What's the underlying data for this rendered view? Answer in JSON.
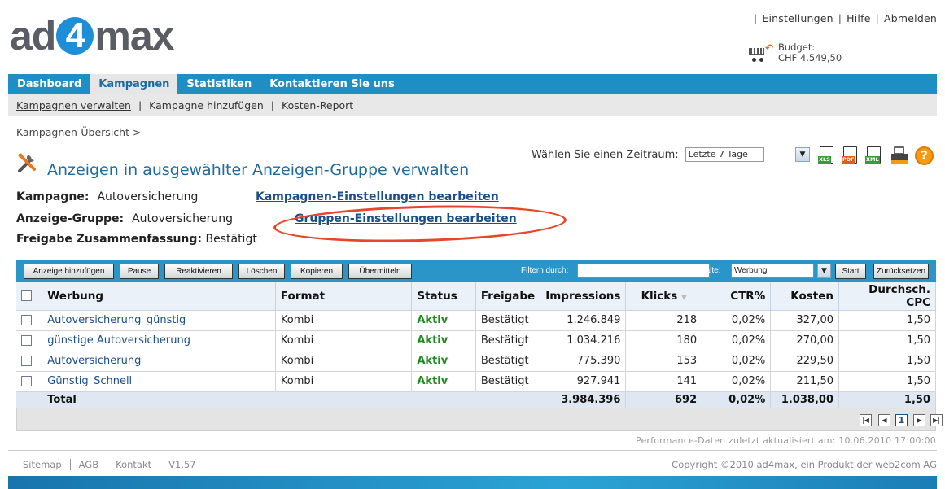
{
  "top_links": [
    "Einstellungen",
    "Hilfe",
    "Abmelden"
  ],
  "logo": {
    "pre": "ad",
    "mid": "4",
    "post": "max"
  },
  "budget": {
    "label": "Budget:",
    "value": "CHF 4.549,50"
  },
  "main_nav": [
    {
      "label": "Dashboard",
      "active": false
    },
    {
      "label": "Kampagnen",
      "active": true
    },
    {
      "label": "Statistiken",
      "active": false
    },
    {
      "label": "Kontaktieren Sie uns",
      "active": false
    }
  ],
  "sub_nav": [
    "Kampagnen verwalten",
    "Kampagne hinzufügen",
    "Kosten-Report"
  ],
  "breadcrumb": "Kampagnen-Übersicht >",
  "page_title": "Anzeigen in ausgewählter Anzeigen-Gruppe verwalten",
  "period": {
    "label": "Wählen Sie einen Zeitraum:",
    "selected": "Letzte 7 Tage"
  },
  "export_icons": [
    "XLS",
    "PDF",
    "XML"
  ],
  "info": {
    "kampagne_label": "Kampagne:",
    "kampagne_value": "Autoversicherung",
    "kampagne_link": "Kampagnen-Einstellungen bearbeiten",
    "gruppe_label": "Anzeige-Gruppe:",
    "gruppe_value": "Autoversicherung",
    "gruppe_link": "Gruppen-Einstellungen bearbeiten",
    "freigabe_label": "Freigabe Zusammenfassung:",
    "freigabe_value": "Bestätigt"
  },
  "toolbar": {
    "buttons": [
      "Anzeige hinzufügen",
      "Pause",
      "Reaktivieren",
      "Löschen",
      "Kopieren",
      "Übermitteln"
    ],
    "filter_label": "Filtern durch:",
    "column_label": "In der Spalte:",
    "column_selected": "Werbung",
    "start": "Start",
    "reset": "Zurücksetzen"
  },
  "table": {
    "headers": [
      "Werbung",
      "Format",
      "Status",
      "Freigabe",
      "Impressions",
      "Klicks",
      "CTR%",
      "Kosten",
      "Durchsch. CPC"
    ],
    "rows": [
      [
        "Autoversicherung_günstig",
        "Kombi",
        "Aktiv",
        "Bestätigt",
        "1.246.849",
        "218",
        "0,02%",
        "327,00",
        "1,50"
      ],
      [
        "günstige Autoversicherung",
        "Kombi",
        "Aktiv",
        "Bestätigt",
        "1.034.216",
        "180",
        "0,02%",
        "270,00",
        "1,50"
      ],
      [
        "Autoversicherung",
        "Kombi",
        "Aktiv",
        "Bestätigt",
        "775.390",
        "153",
        "0,02%",
        "229,50",
        "1,50"
      ],
      [
        "Günstig_Schnell",
        "Kombi",
        "Aktiv",
        "Bestätigt",
        "927.941",
        "141",
        "0,02%",
        "211,50",
        "1,50"
      ]
    ],
    "total": {
      "label": "Total",
      "impressions": "3.984.396",
      "klicks": "692",
      "ctr": "0,02%",
      "kosten": "1.038,00",
      "cpc": "1,50"
    }
  },
  "pager": {
    "current": "1"
  },
  "performance_note": "Performance-Daten zuletzt aktualisiert am:  10.06.2010 17:00:00",
  "footer": {
    "links": [
      "Sitemap",
      "AGB",
      "Kontakt",
      "V1.57"
    ],
    "copyright": "Copyright ©2010 ad4max, ein Produkt der web2com AG"
  },
  "colors": {
    "nav": "#1e8fc4",
    "toolbar": "#2a95c9",
    "link": "#1a4f8a",
    "active_status": "#1f8a1f",
    "highlight_ellipse": "#e8452a"
  }
}
